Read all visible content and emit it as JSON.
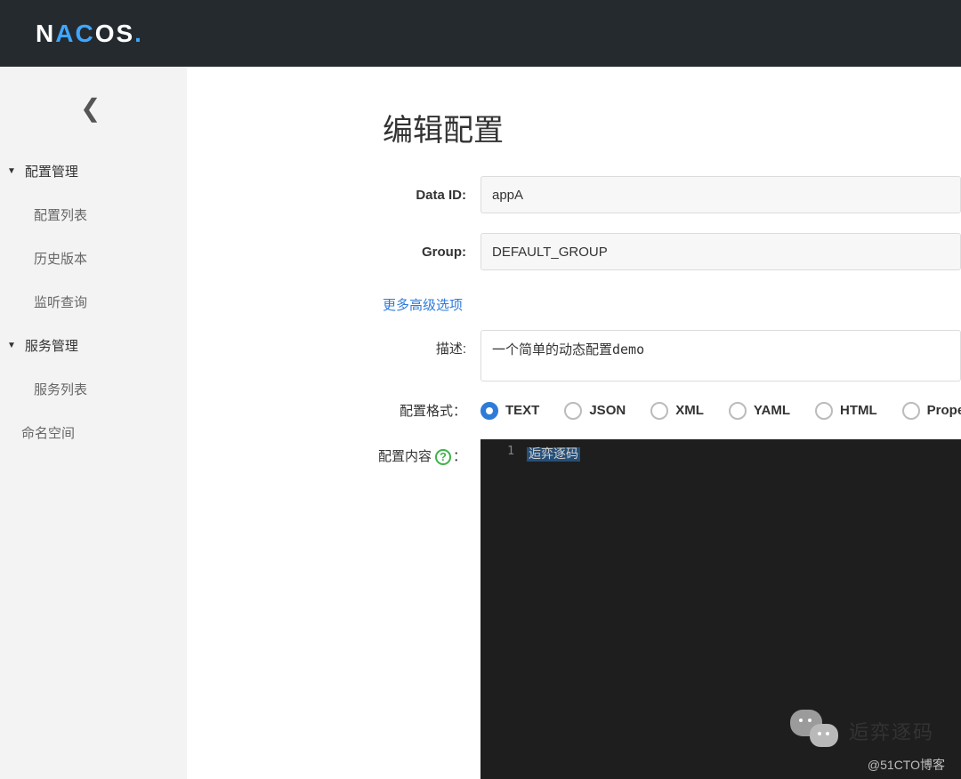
{
  "header": {
    "logo_prefix": "N",
    "logo_mid": "AC",
    "logo_suffix": "OS",
    "logo_dot": "."
  },
  "sidebar": {
    "groups": [
      {
        "label": "配置管理",
        "items": [
          "配置列表",
          "历史版本",
          "监听查询"
        ]
      },
      {
        "label": "服务管理",
        "items": [
          "服务列表"
        ]
      }
    ],
    "extra_item": "命名空间"
  },
  "page": {
    "title": "编辑配置",
    "data_id_label": "Data ID:",
    "data_id_value": "appA",
    "group_label": "Group:",
    "group_value": "DEFAULT_GROUP",
    "advanced_link": "更多高级选项",
    "desc_label": "描述:",
    "desc_value": "一个简单的动态配置demo",
    "format_label": "配置格式：",
    "formats": [
      "TEXT",
      "JSON",
      "XML",
      "YAML",
      "HTML",
      "Properties"
    ],
    "format_selected": 0,
    "content_label": "配置内容",
    "content_help": "?",
    "content_colon": "：",
    "editor_line1_num": "1",
    "editor_line1_text": "逅弈逐码",
    "watermark": "@51CTO博客",
    "wechat_text": "逅弈逐码"
  }
}
